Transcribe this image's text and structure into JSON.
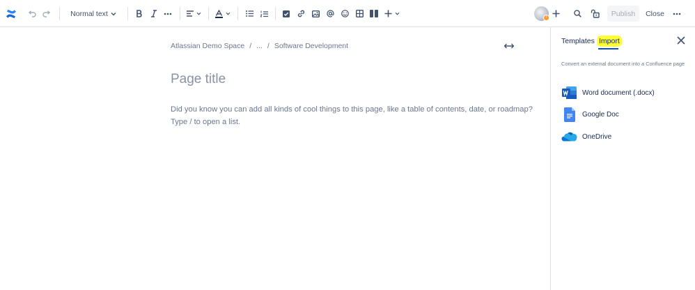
{
  "toolbar": {
    "text_style": "Normal text",
    "publish_label": "Publish",
    "close_label": "Close",
    "avatar_badge": "!"
  },
  "editor": {
    "breadcrumb": [
      "Atlassian Demo Space",
      "...",
      "Software Development"
    ],
    "breadcrumb_separator": "/",
    "title_placeholder": "Page title",
    "body_placeholder_line1": "Did you know you can add all kinds of cool things to this page, like a table of contents, date, or roadmap?",
    "body_placeholder_line2": "Type / to open a list."
  },
  "panel": {
    "tabs": [
      {
        "label": "Templates",
        "active": false
      },
      {
        "label": "Import",
        "active": true,
        "highlighted": true
      }
    ],
    "description": "Convert an external document into a Confluence page",
    "import_options": [
      {
        "label": "Word document (.docx)",
        "icon": "word-icon"
      },
      {
        "label": "Google Doc",
        "icon": "google-doc-icon"
      },
      {
        "label": "OneDrive",
        "icon": "onedrive-icon"
      }
    ]
  },
  "colors": {
    "brand": "#0052cc",
    "highlight": "#ffff33",
    "word": "#185abd",
    "google_doc": "#4285f4",
    "onedrive": "#0364b8"
  }
}
